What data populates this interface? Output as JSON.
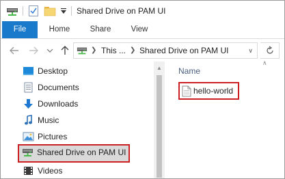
{
  "titlebar": {
    "title": "Shared Drive on PAM UI",
    "icons": [
      "drive-icon",
      "properties-icon",
      "new-folder-icon",
      "customize-toolbar-dropdown-icon"
    ]
  },
  "ribbon": {
    "tabs": [
      "File",
      "Home",
      "Share",
      "View"
    ],
    "active_tab": "File",
    "accent_color": "#1979ca"
  },
  "address": {
    "back_icon": "arrow-left-icon",
    "forward_icon": "arrow-right-icon",
    "up_icon": "arrow-up-icon",
    "segment_1": "This ...",
    "segment_2": "Shared Drive on PAM UI",
    "refresh_icon": "refresh-icon"
  },
  "navpane": {
    "items": [
      {
        "label": "Desktop",
        "icon": "desktop-icon"
      },
      {
        "label": "Documents",
        "icon": "documents-icon"
      },
      {
        "label": "Downloads",
        "icon": "downloads-icon"
      },
      {
        "label": "Music",
        "icon": "music-icon"
      },
      {
        "label": "Pictures",
        "icon": "pictures-icon"
      },
      {
        "label": "Shared Drive on PAM UI",
        "icon": "network-drive-icon",
        "selected": true
      },
      {
        "label": "Videos",
        "icon": "videos-icon"
      }
    ],
    "highlight_color": "#cc1f24"
  },
  "content": {
    "column_header": "Name",
    "files": [
      {
        "name": "hello-world",
        "icon": "text-file-icon"
      }
    ]
  }
}
